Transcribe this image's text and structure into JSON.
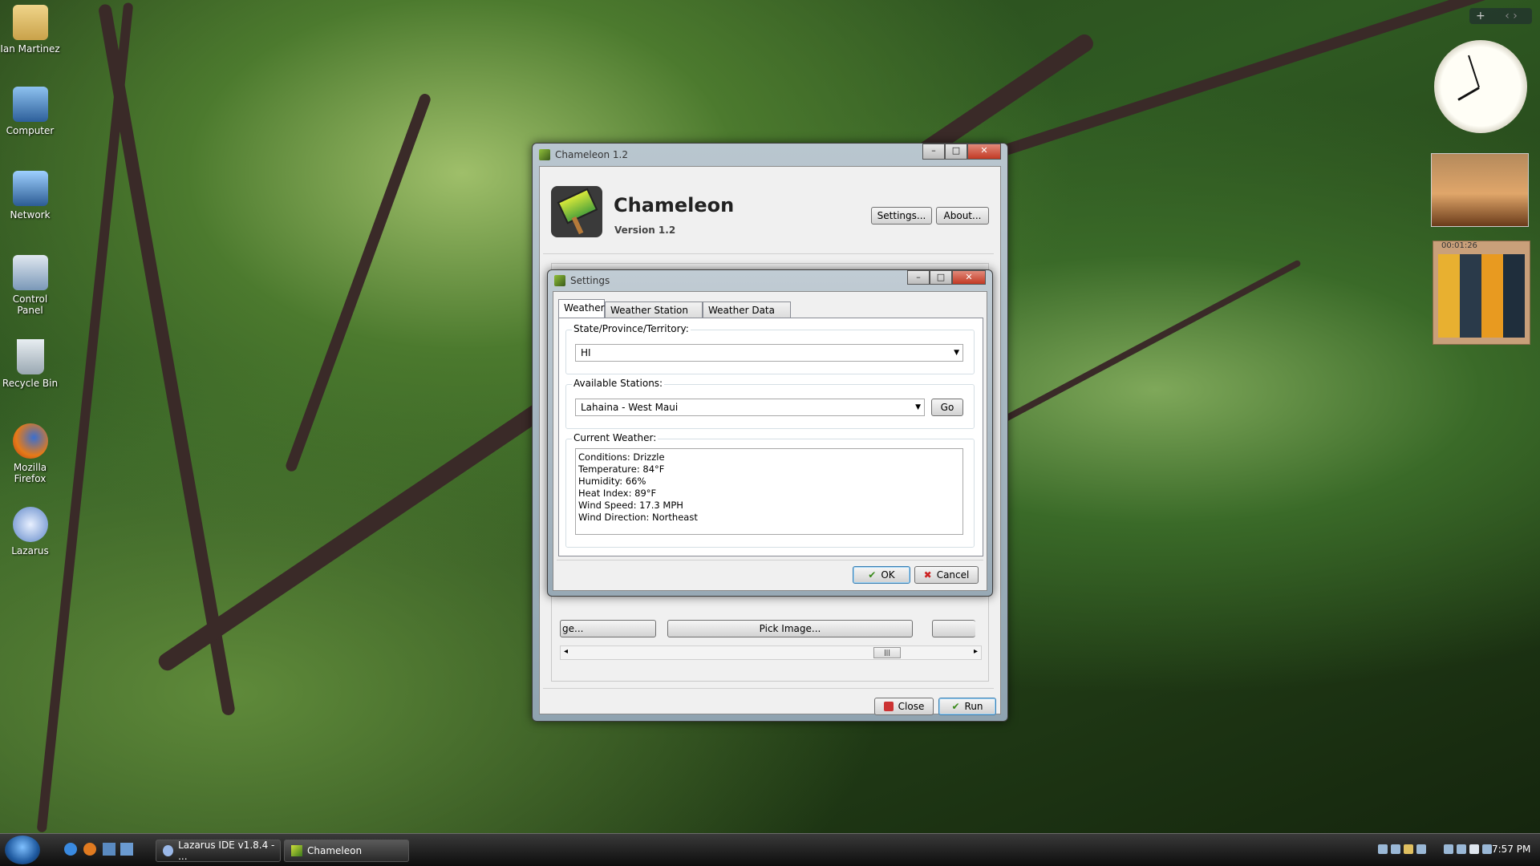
{
  "desktop": {
    "icons": [
      {
        "label": "Ian Martinez"
      },
      {
        "label": "Computer"
      },
      {
        "label": "Network"
      },
      {
        "label": "Control Panel"
      },
      {
        "label": "Recycle Bin"
      },
      {
        "label": "Mozilla Firefox"
      },
      {
        "label": "Lazarus"
      }
    ]
  },
  "main_window": {
    "title": "Chameleon 1.2",
    "app_name": "Chameleon",
    "version": "Version 1.2",
    "settings_button": "Settings...",
    "about_button": "About...",
    "image_button_left": "ge...",
    "pick_image_button": "Pick Image...",
    "scroll_thumb": "|||",
    "close_button": "Close",
    "run_button": "Run"
  },
  "dialog": {
    "title": "Settings",
    "tabs": [
      "Weather",
      "Weather Station XML",
      "Weather Data XML"
    ],
    "active_tab": "Weather",
    "state_label": "State/Province/Territory:",
    "state_value": "HI",
    "stations_label": "Available Stations:",
    "station_value": "Lahaina - West Maui",
    "go_button": "Go",
    "current_label": "Current Weather:",
    "weather_lines": [
      "Conditions: Drizzle",
      "Temperature: 84°F",
      "Humidity: 66%",
      "Heat Index: 89°F",
      "Wind Speed: 17.3 MPH",
      "Wind Direction: Northeast"
    ],
    "ok_button": "OK",
    "cancel_button": "Cancel"
  },
  "gadgets": {
    "timer": "00:01:26"
  },
  "taskbar": {
    "items": [
      "Lazarus IDE v1.8.4 - ...",
      "Chameleon"
    ],
    "clock": "7:57 PM"
  },
  "colors": {
    "accent": "#3c7fb1",
    "dialog_bg": "#f0f0f0",
    "close_red": "#c23a25"
  }
}
